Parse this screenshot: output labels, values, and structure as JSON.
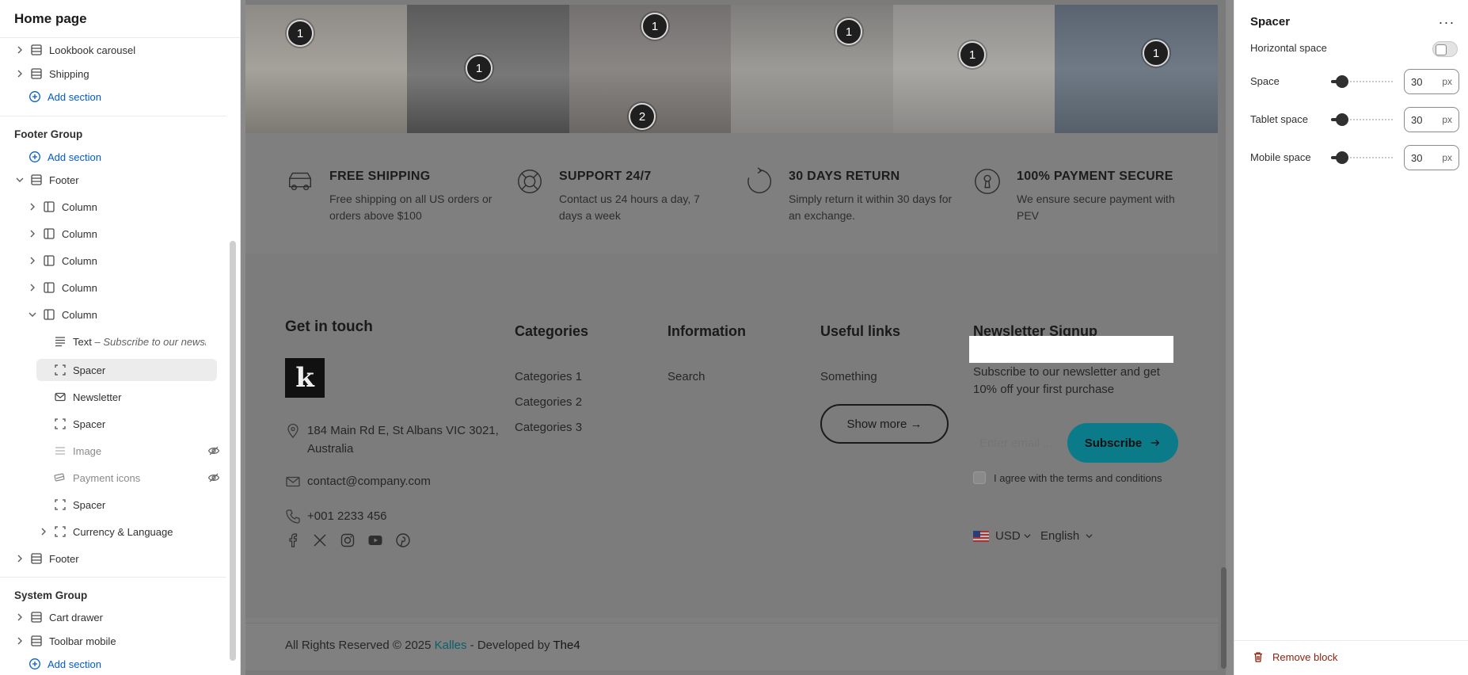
{
  "sidebar": {
    "title": "Home page",
    "rows_top": [
      {
        "label": "Lookbook carousel"
      },
      {
        "label": "Shipping"
      }
    ],
    "add_section": "Add section",
    "footer_group": {
      "title": "Footer Group",
      "add_section": "Add section",
      "footer": "Footer",
      "columns": [
        "Column",
        "Column",
        "Column",
        "Column",
        "Column"
      ],
      "column_children": [
        {
          "label": "Text",
          "suffix": "Subscribe to our newsl..."
        },
        {
          "label": "Spacer"
        },
        {
          "label": "Newsletter"
        },
        {
          "label": "Spacer"
        },
        {
          "label": "Image",
          "hidden": true
        },
        {
          "label": "Payment icons",
          "hidden": true
        },
        {
          "label": "Spacer"
        },
        {
          "label": "Currency & Language"
        }
      ],
      "footer_2": "Footer"
    },
    "system_group": {
      "title": "System Group",
      "items": [
        "Cart drawer",
        "Toolbar mobile"
      ],
      "add_section": "Add section"
    }
  },
  "preview": {
    "hotspots": [
      "1",
      "1",
      "1",
      "2",
      "1",
      "1",
      "1"
    ],
    "features": [
      {
        "title": "FREE SHIPPING",
        "desc": "Free shipping on all US orders or orders above $100",
        "icon": "truck-icon"
      },
      {
        "title": "SUPPORT 24/7",
        "desc": "Contact us 24 hours a day, 7 days a week",
        "icon": "lifebuoy-icon"
      },
      {
        "title": "30 DAYS RETURN",
        "desc": "Simply return it within 30 days for an exchange.",
        "icon": "refresh-icon"
      },
      {
        "title": "100% PAYMENT SECURE",
        "desc": "We ensure secure payment with PEV",
        "icon": "keyhole-icon"
      }
    ],
    "footer": {
      "get_in_touch": "Get in touch",
      "logo_letter": "k",
      "address": "184 Main Rd E, St Albans VIC 3021, Australia",
      "email": "contact@company.com",
      "phone": "+001 2233 456",
      "categories": {
        "title": "Categories",
        "links": [
          "Categories 1",
          "Categories 2",
          "Categories 3"
        ]
      },
      "information": {
        "title": "Information",
        "links": [
          "Search"
        ]
      },
      "useful_links": {
        "title": "Useful links",
        "links": [
          "Something"
        ],
        "show_more": "Show more →"
      },
      "newsletter": {
        "title": "Newsletter Signup",
        "desc": "Subscribe to our newsletter and get 10% off your first purchase",
        "placeholder": "Enter email ...",
        "button": "Subscribe",
        "agree": "I agree with the terms and conditions"
      },
      "currency": "USD",
      "language": "English"
    },
    "copyright": {
      "prefix": "All Rights Reserved © 2025 ",
      "brand": "Kalles",
      "middle": " - Developed by ",
      "developer": "The4"
    }
  },
  "panel": {
    "title": "Spacer",
    "more": "···",
    "horizontal_space": "Horizontal space",
    "settings": [
      {
        "label": "Space",
        "value": "30",
        "unit": "px",
        "fraction": 0.18
      },
      {
        "label": "Tablet space",
        "value": "30",
        "unit": "px",
        "fraction": 0.18
      },
      {
        "label": "Mobile space",
        "value": "30",
        "unit": "px",
        "fraction": 0.18
      }
    ],
    "remove_block": "Remove block"
  },
  "colors": {
    "accent_link": "#005bd3",
    "brand": "#0b7b8a",
    "danger": "#8e1f0b"
  }
}
